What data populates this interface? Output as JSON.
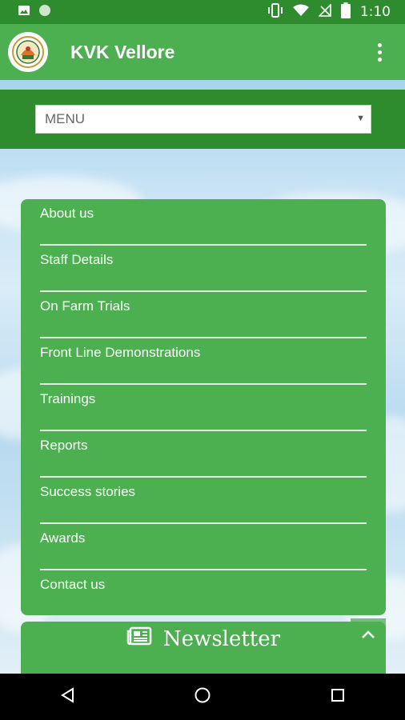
{
  "status_bar": {
    "time": "1:10",
    "icons": [
      "image-icon",
      "circle-icon",
      "vibrate-icon",
      "wifi-icon",
      "no-signal-icon",
      "battery-icon"
    ]
  },
  "app_bar": {
    "title": "KVK Vellore",
    "overflow_icon": "more-vert-icon"
  },
  "menu": {
    "selected": "MENU"
  },
  "links": [
    {
      "label": "About us"
    },
    {
      "label": "Staff Details"
    },
    {
      "label": "On Farm Trials"
    },
    {
      "label": "Front Line Demonstrations"
    },
    {
      "label": "Trainings"
    },
    {
      "label": "Reports"
    },
    {
      "label": "Success stories"
    },
    {
      "label": "Awards"
    },
    {
      "label": "Contact us"
    }
  ],
  "newsletter": {
    "title": "Newsletter",
    "icon": "newspaper-icon"
  },
  "scroll_top_icon": "chevron-up-icon",
  "nav_bar": {
    "icons": [
      "back-icon",
      "home-icon",
      "recents-icon"
    ]
  },
  "colors": {
    "primary": "#4caf50",
    "primary_dark": "#2e8b2e",
    "text_on_primary": "#ffffff"
  }
}
